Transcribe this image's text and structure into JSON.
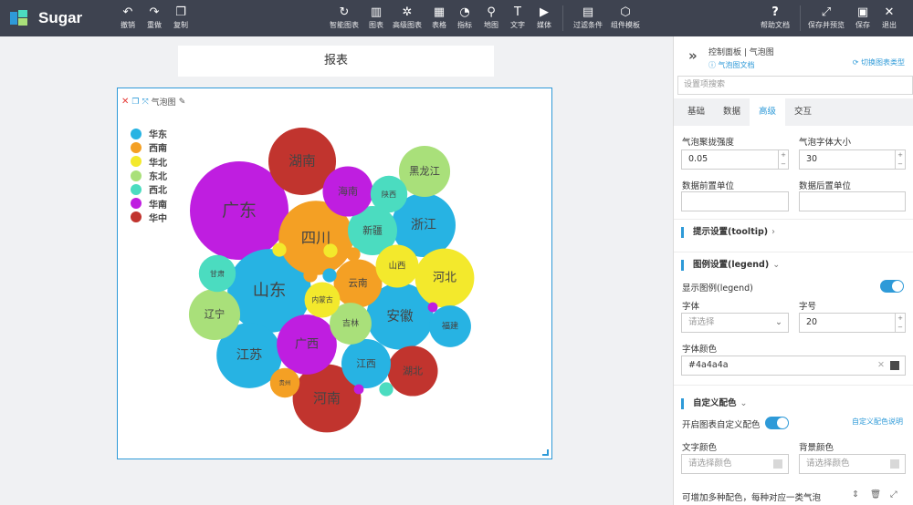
{
  "app": {
    "brand": "Sugar"
  },
  "toolbar": {
    "undo": "撤销",
    "redo": "重做",
    "copy": "复制",
    "smart_chart": "智能图表",
    "chart": "图表",
    "advanced_chart": "高级图表",
    "table": "表格",
    "indicator": "指标",
    "map": "地图",
    "text": "文字",
    "media": "媒体",
    "filter": "过滤条件",
    "component_template": "组件模板",
    "help": "帮助文档",
    "save_preview": "保存并预览",
    "save": "保存",
    "exit": "退出"
  },
  "canvas": {
    "report_title": "报表",
    "widget_name": "气泡图"
  },
  "chart_data": {
    "type": "bubble",
    "legend": [
      {
        "name": "华东",
        "color": "#27b3e3"
      },
      {
        "name": "西南",
        "color": "#f4a024"
      },
      {
        "name": "华北",
        "color": "#f3e92c"
      },
      {
        "name": "东北",
        "color": "#a9e07a"
      },
      {
        "name": "西北",
        "color": "#4bdcc0"
      },
      {
        "name": "华南",
        "color": "#bf1ee0"
      },
      {
        "name": "华中",
        "color": "#c1342e"
      }
    ],
    "bubbles": [
      {
        "name": "广东",
        "region": "华南",
        "size": 100
      },
      {
        "name": "山东",
        "region": "华东",
        "size": 72
      },
      {
        "name": "河南",
        "region": "华中",
        "size": 48
      },
      {
        "name": "四川",
        "region": "西南",
        "size": 57
      },
      {
        "name": "湖南",
        "region": "华中",
        "size": 47
      },
      {
        "name": "安徽",
        "region": "华东",
        "size": 46
      },
      {
        "name": "浙江",
        "region": "华东",
        "size": 42
      },
      {
        "name": "江苏",
        "region": "华东",
        "size": 44
      },
      {
        "name": "河北",
        "region": "华北",
        "size": 36
      },
      {
        "name": "广西",
        "region": "华南",
        "size": 37
      },
      {
        "name": "湖北",
        "region": "华中",
        "size": 26
      },
      {
        "name": "辽宁",
        "region": "东北",
        "size": 27
      },
      {
        "name": "黑龙江",
        "region": "东北",
        "size": 27
      },
      {
        "name": "新疆",
        "region": "西北",
        "size": 25
      },
      {
        "name": "海南",
        "region": "华南",
        "size": 26
      },
      {
        "name": "江西",
        "region": "华东",
        "size": 25
      },
      {
        "name": "云南",
        "region": "西南",
        "size": 24
      },
      {
        "name": "福建",
        "region": "华东",
        "size": 18
      },
      {
        "name": "吉林",
        "region": "东北",
        "size": 18
      },
      {
        "name": "山西",
        "region": "华北",
        "size": 19
      },
      {
        "name": "陕西",
        "region": "西北",
        "size": 14
      },
      {
        "name": "内蒙古",
        "region": "华北",
        "size": 13
      },
      {
        "name": "甘肃",
        "region": "西北",
        "size": 14
      },
      {
        "name": "贵州",
        "region": "西南",
        "size": 9
      },
      {
        "name": "",
        "region": "华北",
        "size": 2
      },
      {
        "name": "",
        "region": "华北",
        "size": 2
      },
      {
        "name": "",
        "region": "华东",
        "size": 2
      },
      {
        "name": "",
        "region": "西南",
        "size": 2
      },
      {
        "name": "",
        "region": "西南",
        "size": 2
      },
      {
        "name": "",
        "region": "西北",
        "size": 2
      },
      {
        "name": "",
        "region": "华南",
        "size": 1
      },
      {
        "name": "",
        "region": "华南",
        "size": 1
      }
    ]
  },
  "panel": {
    "title": "控制面板 | 气泡图",
    "doc_link": "气泡图文档",
    "switch_chart": "切换图表类型",
    "search_placeholder": "设置项搜索",
    "tabs": [
      "基础",
      "数据",
      "高级",
      "交互"
    ],
    "active_tab": "高级",
    "bubble_gather_label": "气泡聚拢强度",
    "bubble_gather_value": "0.05",
    "bubble_font_label": "气泡字体大小",
    "bubble_font_value": "30",
    "prefix_unit_label": "数据前置单位",
    "suffix_unit_label": "数据后置单位",
    "tooltip_section": "提示设置(tooltip)",
    "legend_section": "图例设置(legend)",
    "show_legend_label": "显示图例(legend)",
    "font_label": "字体",
    "font_placeholder": "请选择",
    "size_label": "字号",
    "size_value": "20",
    "font_color_label": "字体颜色",
    "font_color_value": "#4a4a4a",
    "custom_color_section": "自定义配色",
    "enable_custom_color_label": "开启图表自定义配色",
    "custom_color_help": "自定义配色说明",
    "text_color_label": "文字颜色",
    "bg_color_label": "背景颜色",
    "color_placeholder": "请选择颜色",
    "multi_color_hint": "可增加多种配色，每种对应一类气泡"
  }
}
